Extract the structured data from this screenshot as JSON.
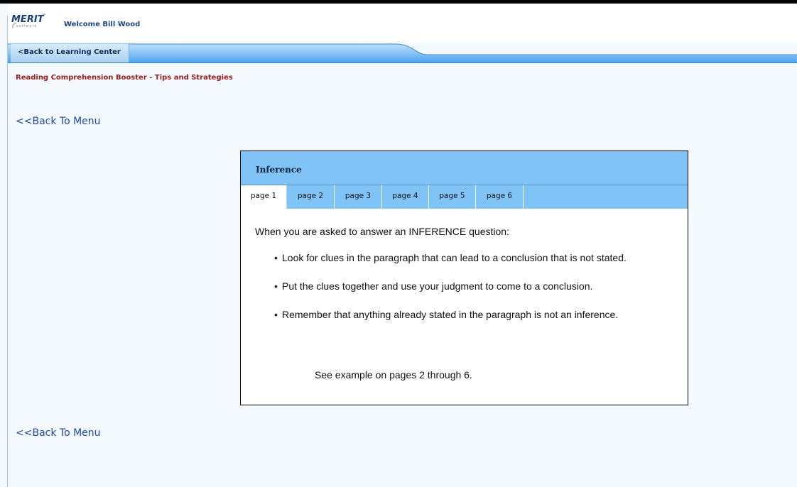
{
  "header": {
    "logo_text": "MERIT",
    "logo_tm": "™",
    "logo_sub": "software",
    "welcome": "Welcome Bill Wood"
  },
  "nav": {
    "back_to_learning_center": "<Back to Learning Center"
  },
  "page": {
    "subtitle": "Reading Comprehension Booster - Tips and Strategies",
    "back_to_menu": "<<Back To Menu"
  },
  "panel": {
    "title": "Inference",
    "tabs": [
      "page 1",
      "page 2",
      "page 3",
      "page 4",
      "page 5",
      "page 6"
    ],
    "active_tab": "page 1",
    "lead": "When you are asked to answer an INFERENCE question:",
    "bullets": [
      "Look for clues in the paragraph that can lead to a conclusion that is not stated.",
      "Put the clues together and use your judgment to come to a conclusion.",
      "Remember that anything already stated in the paragraph is not an inference."
    ],
    "note": "See example on pages 2 through 6."
  },
  "colors": {
    "page_bg": "#f3f9fd",
    "panel_header": "#7fc3f7",
    "nav_blue": "#4aa3ef",
    "subtitle_red": "#9b1c1c",
    "link_blue": "#1d4aa5"
  }
}
